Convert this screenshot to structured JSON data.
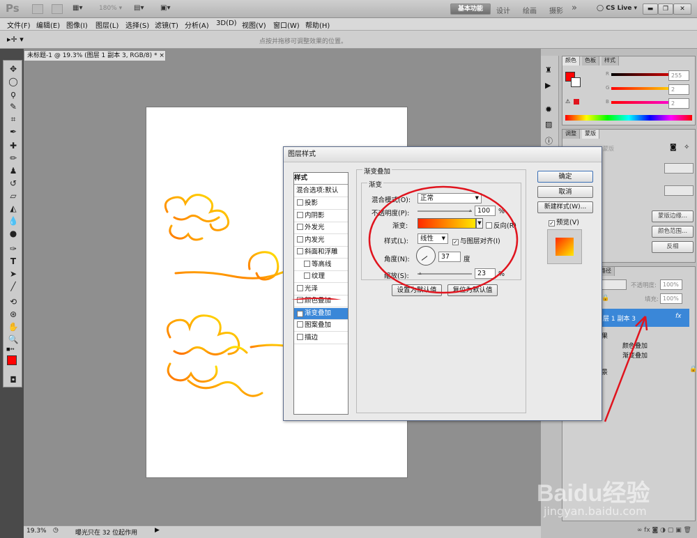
{
  "app": {
    "logo": "Ps",
    "zoom_dropdown": "180%",
    "workspace_buttons": [
      "基本功能",
      "设计",
      "绘画",
      "摄影"
    ],
    "more": "»",
    "cs_live": "CS Live"
  },
  "menu": [
    "文件(F)",
    "编辑(E)",
    "图像(I)",
    "图层(L)",
    "选择(S)",
    "滤镜(T)",
    "分析(A)",
    "3D(D)",
    "视图(V)",
    "窗口(W)",
    "帮助(H)"
  ],
  "options_bar": {
    "hint": "点按并拖移可调整效果的位置。"
  },
  "document": {
    "tab_title": "未标题-1 @ 19.3% (图层 1 副本 3, RGB/8) *",
    "close": "×"
  },
  "status": {
    "zoom": "19.3%",
    "info": "曝光只在 32 位起作用"
  },
  "color_panel": {
    "tabs": [
      "颜色",
      "色板",
      "样式"
    ],
    "r_label": "R",
    "g_label": "G",
    "b_label": "B",
    "r": "255",
    "g": "2",
    "b": "2"
  },
  "adjust_panel": {
    "tabs": [
      "调整",
      "蒙版"
    ],
    "mask_label": "蒙版",
    "buttons": [
      "蒙版边缘...",
      "颜色范围...",
      "反相"
    ]
  },
  "layers_panel": {
    "tab": "路径",
    "opacity_label": "不透明度:",
    "opacity": "100%",
    "fill_label": "填充:",
    "fill": "100%",
    "layer_name": "层 1 副本 3",
    "fx": "fx",
    "effects_header": "果",
    "effects": [
      "颜色叠加",
      "渐变叠加"
    ],
    "bottom_layer": "景"
  },
  "watermark": {
    "brand": "Baidu经验",
    "url": "jingyan.baidu.com"
  },
  "dialog": {
    "title": "图层样式",
    "styles_header": "样式",
    "blend_options": "混合选项:默认",
    "items": [
      {
        "label": "投影",
        "checked": false,
        "indent": false
      },
      {
        "label": "内阴影",
        "checked": false,
        "indent": false
      },
      {
        "label": "外发光",
        "checked": false,
        "indent": false
      },
      {
        "label": "内发光",
        "checked": false,
        "indent": false
      },
      {
        "label": "斜面和浮雕",
        "checked": false,
        "indent": false
      },
      {
        "label": "等高线",
        "checked": false,
        "indent": true
      },
      {
        "label": "纹理",
        "checked": false,
        "indent": true
      },
      {
        "label": "光泽",
        "checked": false,
        "indent": false
      },
      {
        "label": "颜色叠加",
        "checked": false,
        "indent": false
      },
      {
        "label": "渐变叠加",
        "checked": true,
        "indent": false
      },
      {
        "label": "图案叠加",
        "checked": false,
        "indent": false
      },
      {
        "label": "描边",
        "checked": false,
        "indent": false
      }
    ],
    "section_title": "渐变叠加",
    "group_title": "渐变",
    "blend_mode_label": "混合模式(O):",
    "blend_mode": "正常",
    "opacity_label": "不透明度(P):",
    "opacity": "100",
    "percent": "%",
    "gradient_label": "渐变:",
    "reverse_label": "反向(R)",
    "style_label": "样式(L):",
    "style": "线性",
    "align_label": "与图层对齐(I)",
    "angle_label": "角度(N):",
    "angle": "37",
    "degree": "度",
    "scale_label": "缩放(S):",
    "scale": "23",
    "set_default": "设置为默认值",
    "reset_default": "复位为默认值",
    "ok": "确定",
    "cancel": "取消",
    "new_style": "新建样式(W)...",
    "preview": "预览(V)",
    "colors": {
      "grad_start": "#ff2a00",
      "grad_end": "#ffe800",
      "accent": "#e0141e"
    }
  }
}
